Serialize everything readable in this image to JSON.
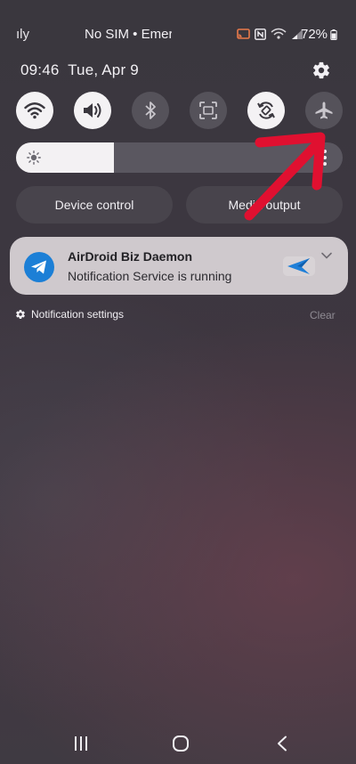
{
  "status_bar": {
    "carrier_left": "ıly",
    "center_text": "No SIM • Emerg",
    "battery_text": "72%",
    "icons": [
      "cast-icon",
      "nfc-icon",
      "wifi-calling-icon",
      "signal-icon",
      "battery-icon"
    ]
  },
  "header": {
    "time": "09:46",
    "date": "Tue, Apr 9",
    "settings_icon": "gear-icon"
  },
  "quick_toggles": [
    {
      "name": "wifi",
      "icon": "wifi-icon",
      "state": "on"
    },
    {
      "name": "sound",
      "icon": "volume-icon",
      "state": "on"
    },
    {
      "name": "bluetooth",
      "icon": "bluetooth-icon",
      "state": "off"
    },
    {
      "name": "screen-capture",
      "icon": "screen-capture-icon",
      "state": "off"
    },
    {
      "name": "auto-rotate",
      "icon": "rotate-icon",
      "state": "on"
    },
    {
      "name": "airplane-mode",
      "icon": "airplane-icon",
      "state": "off"
    }
  ],
  "brightness": {
    "level": 0.3
  },
  "buttons": {
    "device_control": "Device control",
    "media_output": "Media output"
  },
  "notification": {
    "app_name": "AirDroid Biz Daemon",
    "message": "Notification Service is running",
    "app_icon": "telegram-plane-icon"
  },
  "footer": {
    "settings_label": "Notification settings",
    "clear_label": "Clear"
  },
  "colors": {
    "toggle_on": "#f4f2f4",
    "toggle_off": "#55525a",
    "app_icon_bg": "#1c7fd6",
    "annotation_arrow": "#e01030"
  }
}
